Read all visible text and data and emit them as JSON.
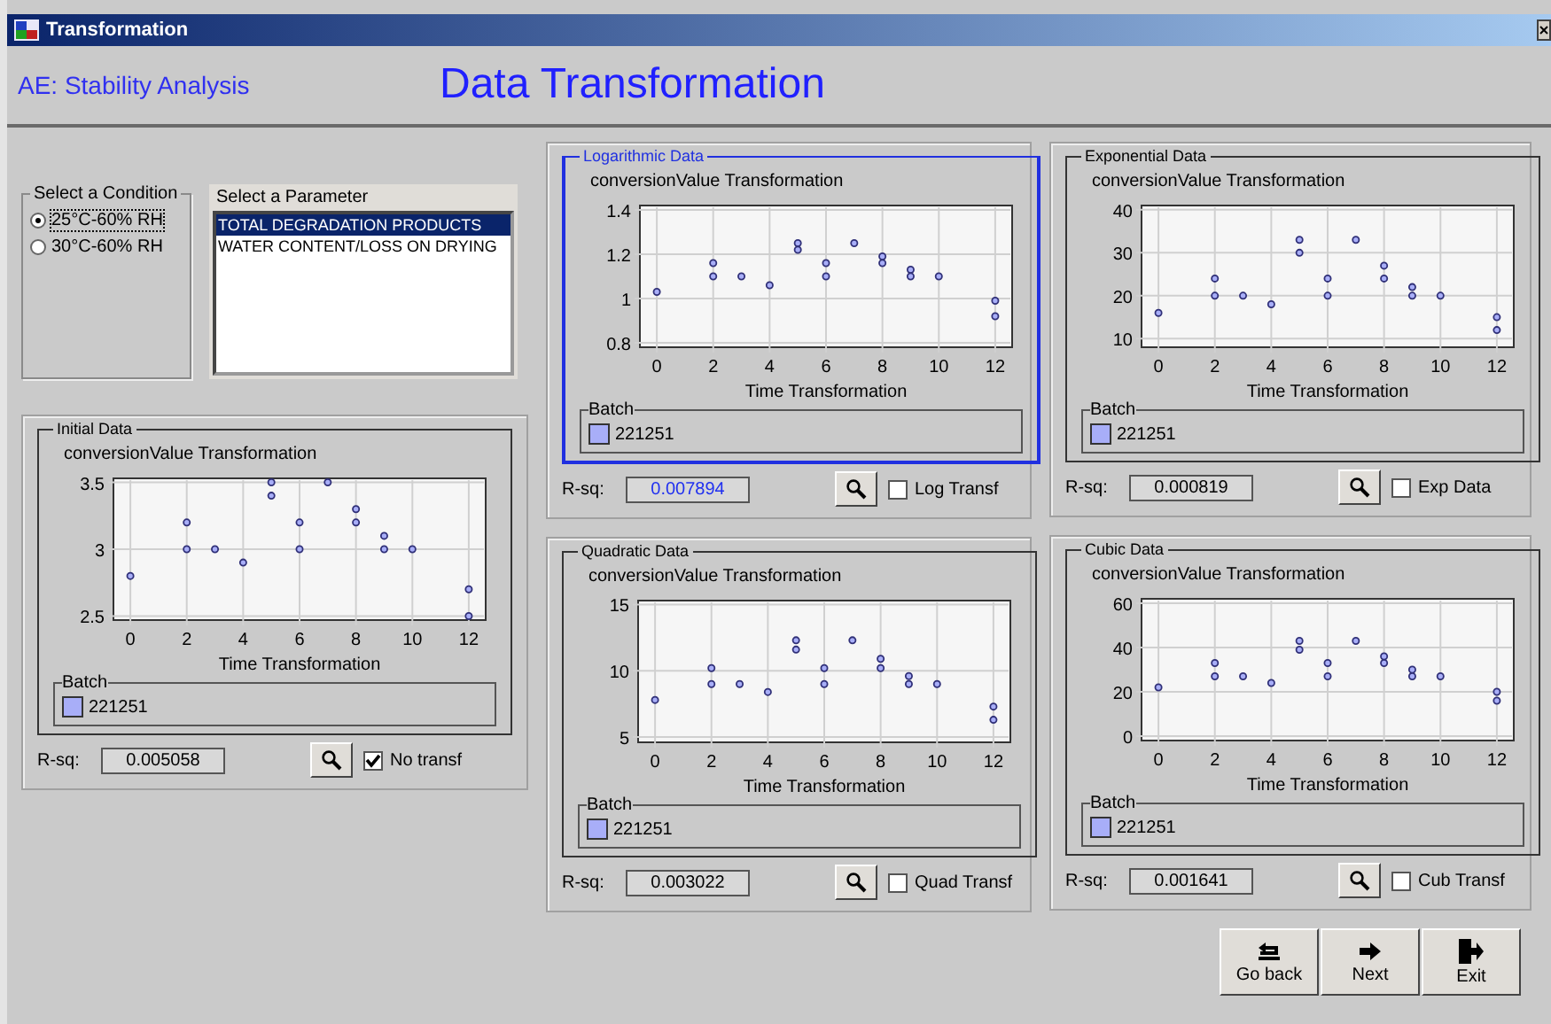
{
  "window": {
    "title": "Transformation"
  },
  "header": {
    "app_name": "AE: Stability Analysis",
    "page_title": "Data Transformation"
  },
  "condition": {
    "label": "Select a Condition",
    "options": [
      {
        "label": "25°C-60% RH",
        "selected": true
      },
      {
        "label": "30°C-60% RH",
        "selected": false
      }
    ]
  },
  "parameter": {
    "label": "Select a Parameter",
    "items": [
      {
        "label": "TOTAL DEGRADATION PRODUCTS",
        "selected": true
      },
      {
        "label": "WATER CONTENT/LOSS ON DRYING",
        "selected": false
      }
    ]
  },
  "panels": [
    {
      "title": "Initial Data",
      "selected": false,
      "batch_label": "Batch",
      "rsq_label": "R-sq:",
      "rsq_value": "0.005058",
      "checkbox": {
        "label": "No transf",
        "checked": true
      },
      "chart_data": {
        "type": "scatter",
        "title": "conversionValue Transformation",
        "xlabel": "Time Transformation",
        "grid": true,
        "x": [
          0,
          2,
          2,
          3,
          4,
          5,
          5,
          6,
          6,
          7,
          8,
          8,
          9,
          9,
          10,
          12,
          12
        ],
        "xlim": [
          -0.6,
          12.6
        ],
        "ylim": [
          2.47,
          3.53
        ],
        "xticks": [
          0,
          2,
          4,
          6,
          8,
          10,
          12
        ],
        "yticks": [
          2.5,
          3,
          3.5
        ],
        "series": [
          {
            "name": "221251",
            "color": "#a8aef8",
            "values": [
              2.8,
              3.2,
              3.0,
              3.0,
              2.9,
              3.5,
              3.4,
              3.2,
              3.0,
              3.5,
              3.3,
              3.2,
              3.1,
              3.0,
              3.0,
              2.7,
              2.5
            ]
          }
        ]
      }
    },
    {
      "title": "Logarithmic Data",
      "selected": true,
      "batch_label": "Batch",
      "rsq_label": "R-sq:",
      "rsq_value": "0.007894",
      "checkbox": {
        "label": "Log Transf",
        "checked": false
      },
      "chart_data": {
        "type": "scatter",
        "title": "conversionValue Transformation",
        "xlabel": "Time Transformation",
        "grid": true,
        "x": [
          0,
          2,
          2,
          3,
          4,
          5,
          5,
          6,
          6,
          7,
          8,
          8,
          9,
          9,
          10,
          12,
          12
        ],
        "xlim": [
          -0.6,
          12.6
        ],
        "ylim": [
          0.78,
          1.42
        ],
        "xticks": [
          0,
          2,
          4,
          6,
          8,
          10,
          12
        ],
        "yticks": [
          0.8,
          1,
          1.2,
          1.4
        ],
        "series": [
          {
            "name": "221251",
            "color": "#a8aef8",
            "values": [
              1.03,
              1.16,
              1.1,
              1.1,
              1.06,
              1.25,
              1.22,
              1.16,
              1.1,
              1.25,
              1.19,
              1.16,
              1.13,
              1.1,
              1.1,
              0.99,
              0.92
            ]
          }
        ]
      }
    },
    {
      "title": "Exponential Data",
      "selected": false,
      "batch_label": "Batch",
      "rsq_label": "R-sq:",
      "rsq_value": "0.000819",
      "checkbox": {
        "label": "Exp Data",
        "checked": false
      },
      "chart_data": {
        "type": "scatter",
        "title": "conversionValue Transformation",
        "xlabel": "Time Transformation",
        "grid": true,
        "x": [
          0,
          2,
          2,
          3,
          4,
          5,
          5,
          6,
          6,
          7,
          8,
          8,
          9,
          9,
          10,
          12,
          12
        ],
        "xlim": [
          -0.6,
          12.6
        ],
        "ylim": [
          8,
          41
        ],
        "xticks": [
          0,
          2,
          4,
          6,
          8,
          10,
          12
        ],
        "yticks": [
          10,
          20,
          30,
          40
        ],
        "series": [
          {
            "name": "221251",
            "color": "#a8aef8",
            "values": [
              16,
              24,
              20,
              20,
              18,
              33,
              30,
              24,
              20,
              33,
              27,
              24,
              22,
              20,
              20,
              15,
              12
            ]
          }
        ]
      }
    },
    {
      "title": "Quadratic Data",
      "selected": false,
      "batch_label": "Batch",
      "rsq_label": "R-sq:",
      "rsq_value": "0.003022",
      "checkbox": {
        "label": "Quad Transf",
        "checked": false
      },
      "chart_data": {
        "type": "scatter",
        "title": "conversionValue Transformation",
        "xlabel": "Time Transformation",
        "grid": true,
        "x": [
          0,
          2,
          2,
          3,
          4,
          5,
          5,
          6,
          6,
          7,
          8,
          8,
          9,
          9,
          10,
          12,
          12
        ],
        "xlim": [
          -0.6,
          12.6
        ],
        "ylim": [
          4.6,
          15.3
        ],
        "xticks": [
          0,
          2,
          4,
          6,
          8,
          10,
          12
        ],
        "yticks": [
          5,
          10,
          15
        ],
        "series": [
          {
            "name": "221251",
            "color": "#a8aef8",
            "values": [
              7.8,
              10.2,
              9,
              9,
              8.4,
              12.3,
              11.6,
              10.2,
              9,
              12.3,
              10.9,
              10.2,
              9.6,
              9,
              9,
              7.3,
              6.3
            ]
          }
        ]
      }
    },
    {
      "title": "Cubic Data",
      "selected": false,
      "batch_label": "Batch",
      "rsq_label": "R-sq:",
      "rsq_value": "0.001641",
      "checkbox": {
        "label": "Cub Transf",
        "checked": false
      },
      "chart_data": {
        "type": "scatter",
        "title": "conversionValue Transformation",
        "xlabel": "Time Transformation",
        "grid": true,
        "x": [
          0,
          2,
          2,
          3,
          4,
          5,
          5,
          6,
          6,
          7,
          8,
          8,
          9,
          9,
          10,
          12,
          12
        ],
        "xlim": [
          -0.6,
          12.6
        ],
        "ylim": [
          -2,
          62
        ],
        "xticks": [
          0,
          2,
          4,
          6,
          8,
          10,
          12
        ],
        "yticks": [
          0,
          20,
          40,
          60
        ],
        "series": [
          {
            "name": "221251",
            "color": "#a8aef8",
            "values": [
              22,
              33,
              27,
              27,
              24,
              43,
              39,
              33,
              27,
              43,
              36,
              33,
              30,
              27,
              27,
              20,
              16
            ]
          }
        ]
      }
    }
  ],
  "buttons": [
    {
      "label": "Go back",
      "kind": "back"
    },
    {
      "label": "Next",
      "kind": "next"
    },
    {
      "label": "Exit",
      "kind": "exit"
    }
  ]
}
